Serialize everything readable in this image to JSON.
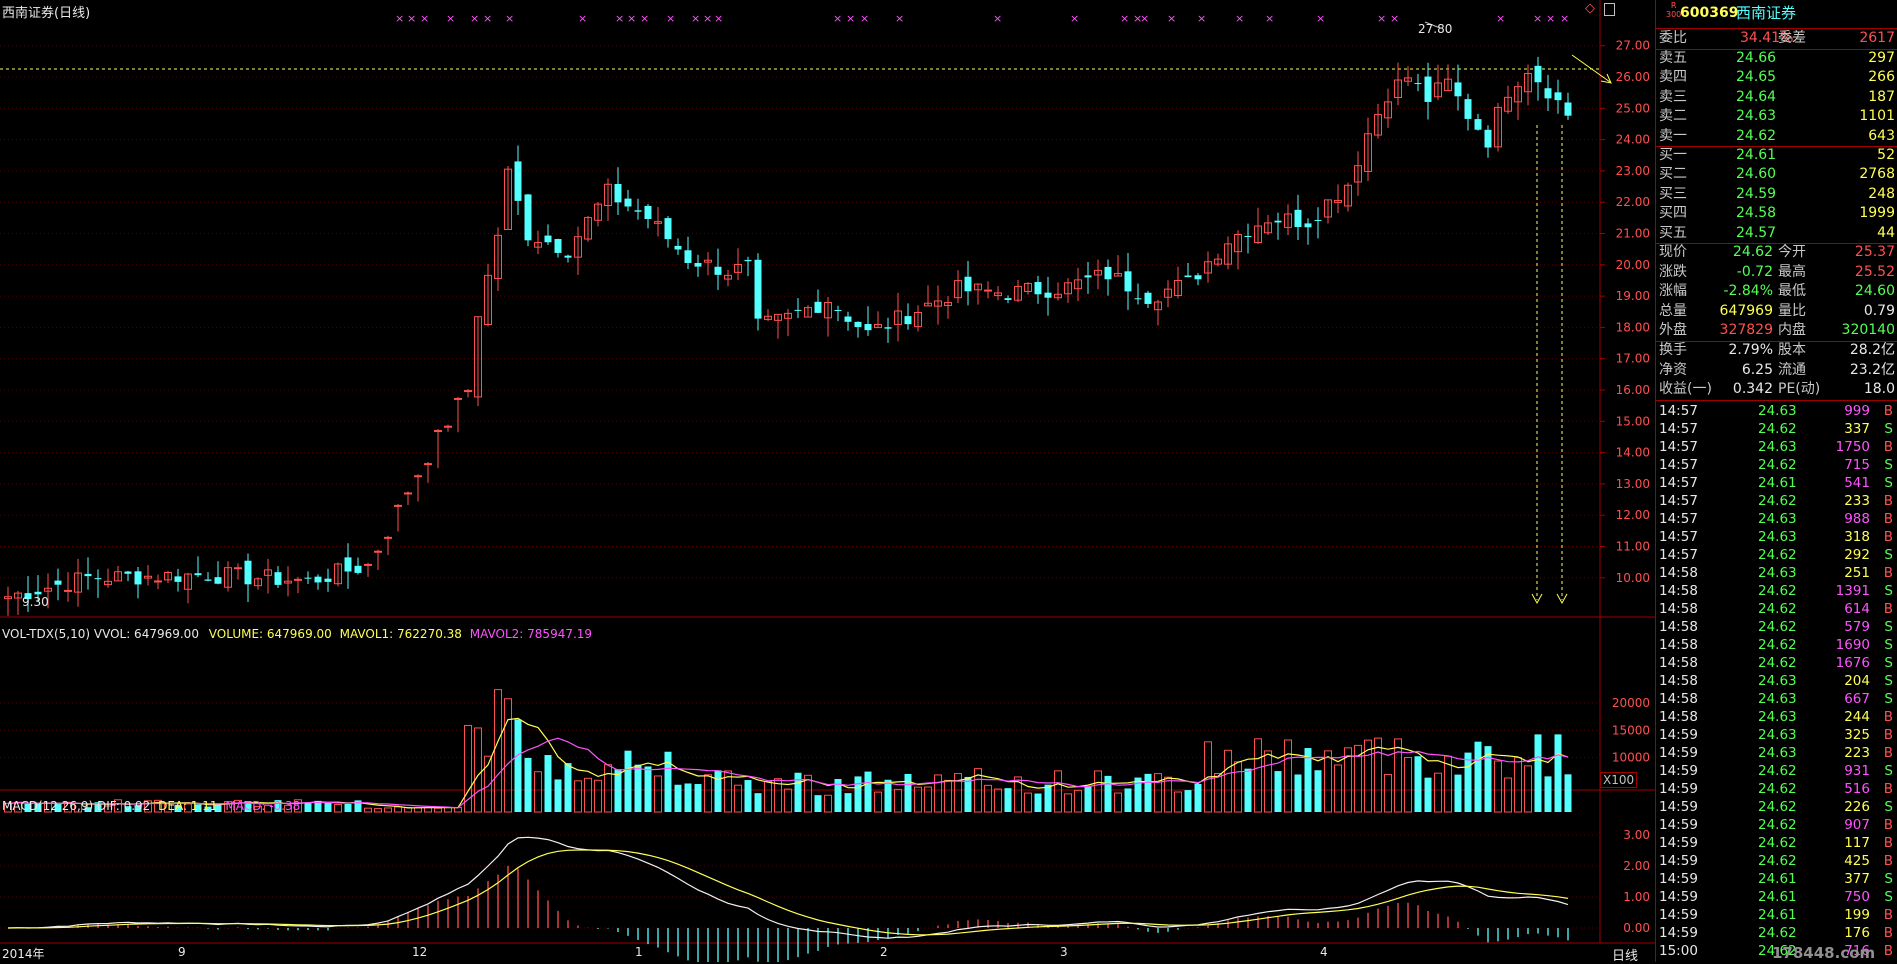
{
  "chart_title": "西南证券(日线)",
  "main_chart": {
    "price_ticks": [
      "27.00",
      "26.00",
      "25.00",
      "24.00",
      "23.00",
      "22.00",
      "21.00",
      "20.00",
      "19.00",
      "18.00",
      "17.00",
      "16.00",
      "15.00",
      "14.00",
      "13.00",
      "12.00",
      "11.00",
      "10.00"
    ],
    "high_label": "27.80",
    "low_label": "9.30"
  },
  "vol_header": {
    "name": "VOL-TDX(5,10)",
    "vvol": "VVOL: 647969.00",
    "volume": "VOLUME: 647969.00",
    "mavol1": "MAVOL1: 762270.38",
    "mavol2": "MAVOL2: 785947.19"
  },
  "vol_ticks": [
    "20000",
    "15000",
    "10000"
  ],
  "vol_unit": "X100",
  "macd_header": {
    "name": "MACD(12,26,9)",
    "dif": "DIF: 0.92",
    "dea": "DEA: 1.11",
    "macd": "MACD: -0.38"
  },
  "macd_ticks": [
    "3.00",
    "2.00",
    "1.00",
    "0.00"
  ],
  "date_axis": [
    "2014年",
    "9",
    "12",
    "1",
    "2",
    "3",
    "4"
  ],
  "period_label": "日线",
  "stock": {
    "code": "600369",
    "name": "西南证券",
    "badge_top": "R",
    "badge_bottom": "300"
  },
  "weibi": {
    "label1": "委比",
    "value1": "34.41%",
    "label2": "委差",
    "value2": "2617"
  },
  "asks": [
    {
      "label": "卖五",
      "price": "24.66",
      "vol": "297"
    },
    {
      "label": "卖四",
      "price": "24.65",
      "vol": "266"
    },
    {
      "label": "卖三",
      "price": "24.64",
      "vol": "187"
    },
    {
      "label": "卖二",
      "price": "24.63",
      "vol": "1101"
    },
    {
      "label": "卖一",
      "price": "24.62",
      "vol": "643"
    }
  ],
  "bids": [
    {
      "label": "买一",
      "price": "24.61",
      "vol": "52"
    },
    {
      "label": "买二",
      "price": "24.60",
      "vol": "2768"
    },
    {
      "label": "买三",
      "price": "24.59",
      "vol": "248"
    },
    {
      "label": "买四",
      "price": "24.58",
      "vol": "1999"
    },
    {
      "label": "买五",
      "price": "24.57",
      "vol": "44"
    }
  ],
  "quote": [
    {
      "l1": "现价",
      "v1": "24.62",
      "l2": "今开",
      "v2": "25.37"
    },
    {
      "l1": "涨跌",
      "v1": "-0.72",
      "l2": "最高",
      "v2": "25.52"
    },
    {
      "l1": "涨幅",
      "v1": "-2.84%",
      "l2": "最低",
      "v2": "24.60"
    },
    {
      "l1": "总量",
      "v1": "647969",
      "l2": "量比",
      "v2": "0.79"
    },
    {
      "l1": "外盘",
      "v1": "327829",
      "l2": "内盘",
      "v2": "320140"
    }
  ],
  "stats": [
    {
      "l1": "换手",
      "v1": "2.79%",
      "l2": "股本",
      "v2": "28.2亿"
    },
    {
      "l1": "净资",
      "v1": "6.25",
      "l2": "流通",
      "v2": "23.2亿"
    },
    {
      "l1": "收益(一)",
      "v1": "0.342",
      "l2": "PE(动)",
      "v2": "18.0"
    }
  ],
  "ticks": [
    {
      "t": "14:57",
      "p": "24.63",
      "v": "999",
      "s": "B"
    },
    {
      "t": "14:57",
      "p": "24.62",
      "v": "337",
      "s": "S"
    },
    {
      "t": "14:57",
      "p": "24.63",
      "v": "1750",
      "s": "B"
    },
    {
      "t": "14:57",
      "p": "24.62",
      "v": "715",
      "s": "S"
    },
    {
      "t": "14:57",
      "p": "24.61",
      "v": "541",
      "s": "S"
    },
    {
      "t": "14:57",
      "p": "24.62",
      "v": "233",
      "s": "B"
    },
    {
      "t": "14:57",
      "p": "24.63",
      "v": "988",
      "s": "B"
    },
    {
      "t": "14:57",
      "p": "24.63",
      "v": "318",
      "s": "B"
    },
    {
      "t": "14:57",
      "p": "24.62",
      "v": "292",
      "s": "S"
    },
    {
      "t": "14:58",
      "p": "24.63",
      "v": "251",
      "s": "B"
    },
    {
      "t": "14:58",
      "p": "24.62",
      "v": "1391",
      "s": "S"
    },
    {
      "t": "14:58",
      "p": "24.62",
      "v": "614",
      "s": "B"
    },
    {
      "t": "14:58",
      "p": "24.62",
      "v": "579",
      "s": "S"
    },
    {
      "t": "14:58",
      "p": "24.62",
      "v": "1690",
      "s": "S"
    },
    {
      "t": "14:58",
      "p": "24.62",
      "v": "1676",
      "s": "S"
    },
    {
      "t": "14:58",
      "p": "24.63",
      "v": "204",
      "s": "S"
    },
    {
      "t": "14:58",
      "p": "24.63",
      "v": "667",
      "s": "S"
    },
    {
      "t": "14:58",
      "p": "24.63",
      "v": "244",
      "s": "B"
    },
    {
      "t": "14:59",
      "p": "24.63",
      "v": "325",
      "s": "B"
    },
    {
      "t": "14:59",
      "p": "24.63",
      "v": "223",
      "s": "B"
    },
    {
      "t": "14:59",
      "p": "24.62",
      "v": "931",
      "s": "S"
    },
    {
      "t": "14:59",
      "p": "24.62",
      "v": "516",
      "s": "B"
    },
    {
      "t": "14:59",
      "p": "24.62",
      "v": "226",
      "s": "S"
    },
    {
      "t": "14:59",
      "p": "24.62",
      "v": "907",
      "s": "B"
    },
    {
      "t": "14:59",
      "p": "24.62",
      "v": "117",
      "s": "B"
    },
    {
      "t": "14:59",
      "p": "24.62",
      "v": "425",
      "s": "B"
    },
    {
      "t": "14:59",
      "p": "24.61",
      "v": "377",
      "s": "S"
    },
    {
      "t": "14:59",
      "p": "24.61",
      "v": "750",
      "s": "S"
    },
    {
      "t": "14:59",
      "p": "24.61",
      "v": "199",
      "s": "B"
    },
    {
      "t": "14:59",
      "p": "24.62",
      "v": "176",
      "s": "B"
    },
    {
      "t": "15:00",
      "p": "24.62",
      "v": "716",
      "s": "B"
    }
  ],
  "watermark": "178448.com",
  "colors": {
    "up": "#ff5050",
    "down": "#54ffff",
    "border": "#a00000",
    "yellow": "#ffff54",
    "magenta": "#ff54ff"
  }
}
